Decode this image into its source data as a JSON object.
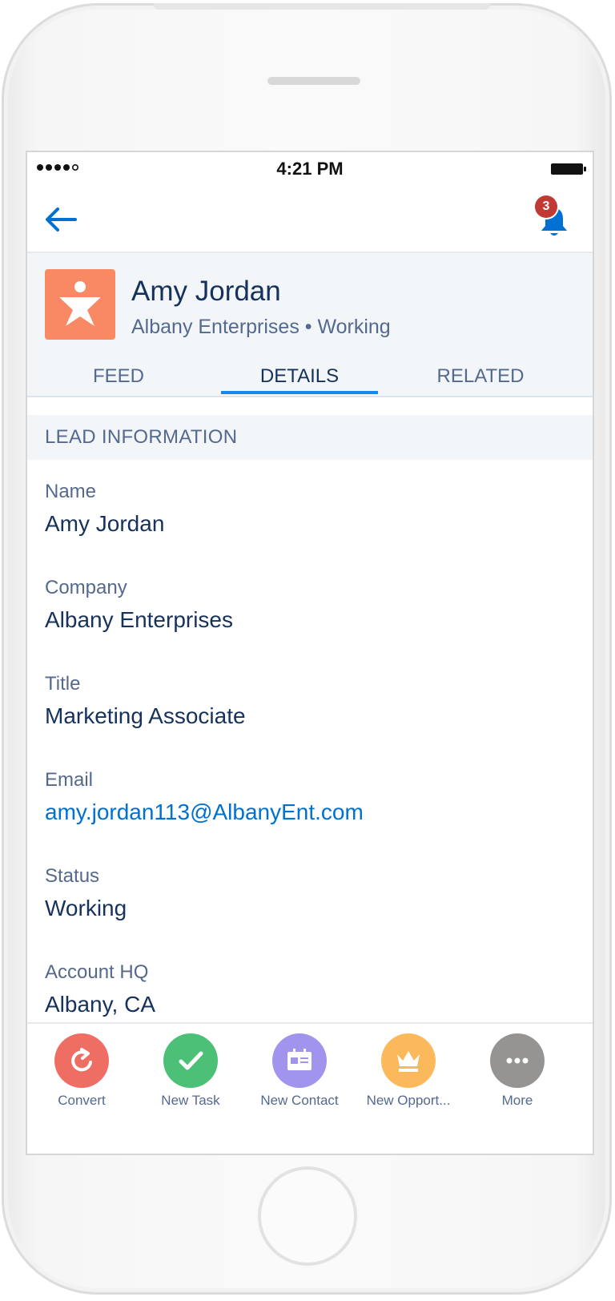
{
  "status_bar": {
    "time": "4:21 PM"
  },
  "notifications": {
    "count": "3"
  },
  "record": {
    "name": "Amy Jordan",
    "subtitle": "Albany Enterprises • Working",
    "icon": "lead-icon",
    "icon_color": "#f88962"
  },
  "tabs": [
    {
      "label": "FEED",
      "active": false
    },
    {
      "label": "DETAILS",
      "active": true
    },
    {
      "label": "RELATED",
      "active": false
    }
  ],
  "section": {
    "title": "LEAD INFORMATION"
  },
  "fields": [
    {
      "label": "Name",
      "value": "Amy Jordan"
    },
    {
      "label": "Company",
      "value": "Albany Enterprises"
    },
    {
      "label": "Title",
      "value": "Marketing Associate"
    },
    {
      "label": "Email",
      "value": "amy.jordan113@AlbanyEnt.com"
    },
    {
      "label": "Status",
      "value": "Working"
    },
    {
      "label": "Account HQ",
      "value": "Albany, CA"
    }
  ],
  "actions": [
    {
      "label": "Convert",
      "icon": "convert-icon",
      "color": "#ef6e64"
    },
    {
      "label": "New Task",
      "icon": "check-icon",
      "color": "#4bc076"
    },
    {
      "label": "New Contact",
      "icon": "contact-card-icon",
      "color": "#a094ed"
    },
    {
      "label": "New Opport...",
      "icon": "crown-icon",
      "color": "#fcb95b"
    },
    {
      "label": "More",
      "icon": "more-icon",
      "color": "#969492"
    }
  ],
  "colors": {
    "accent": "#1589ee",
    "link": "#0070d2",
    "text_primary": "#16325c",
    "text_secondary": "#54698d",
    "badge": "#c23934"
  }
}
